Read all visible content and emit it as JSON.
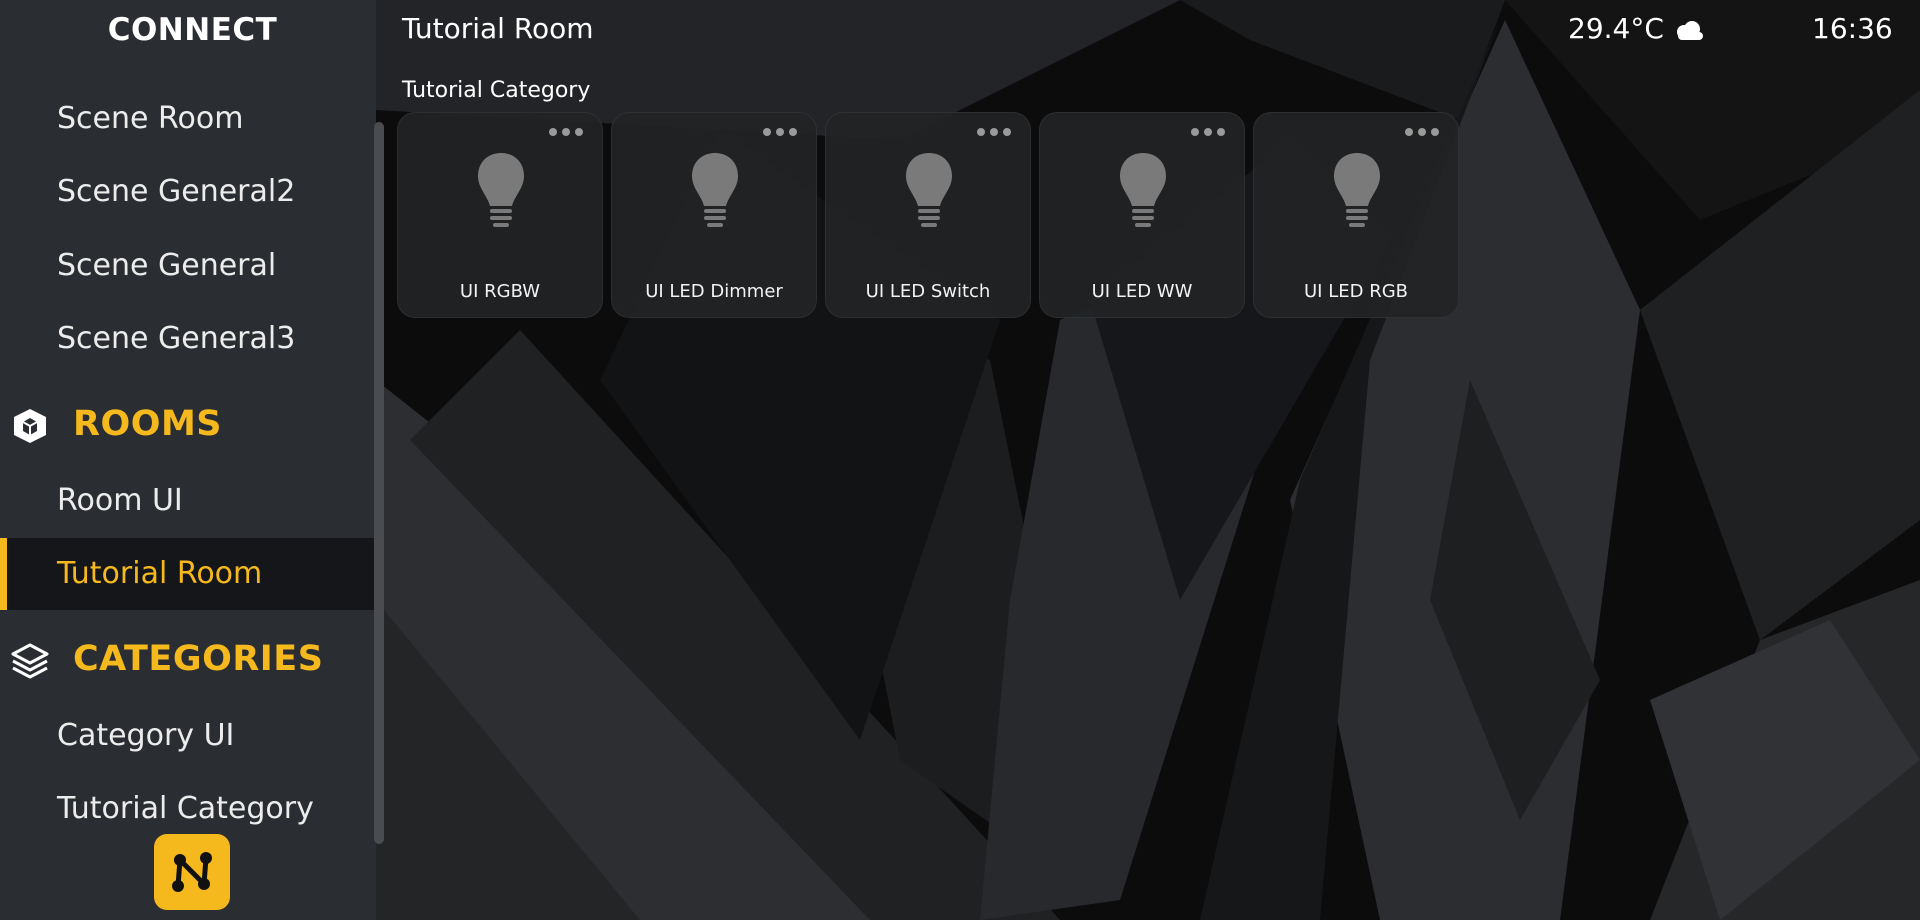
{
  "sidebar": {
    "brand": "CONNECT",
    "scenes": [
      "Scene Room",
      "Scene General2",
      "Scene General",
      "Scene General3"
    ],
    "rooms_header": "ROOMS",
    "rooms": [
      "Room UI",
      "Tutorial Room"
    ],
    "categories_header": "CATEGORIES",
    "categories": [
      "Category UI",
      "Tutorial Category"
    ],
    "active_item": "Tutorial Room",
    "icons": {
      "rooms": "cube-icon",
      "categories": "layers-icon",
      "app": "app-logo-icon"
    }
  },
  "header": {
    "room_title": "Tutorial Room",
    "temperature": "29.4°C",
    "weather_icon": "cloud-icon",
    "time": "16:36"
  },
  "main": {
    "category_title": "Tutorial Category",
    "devices": [
      {
        "label": "UI RGBW",
        "icon": "light-bulb-icon"
      },
      {
        "label": "UI LED Dimmer",
        "icon": "light-bulb-icon"
      },
      {
        "label": "UI LED Switch",
        "icon": "light-bulb-icon"
      },
      {
        "label": "UI LED WW",
        "icon": "light-bulb-icon"
      },
      {
        "label": "UI LED RGB",
        "icon": "light-bulb-icon"
      }
    ]
  },
  "colors": {
    "accent": "#f5b91e",
    "sidebar_bg": "#2a2d31",
    "active_item_bg": "#151619",
    "tile_bg": "#212326",
    "bulb": "#7a7a7a"
  }
}
